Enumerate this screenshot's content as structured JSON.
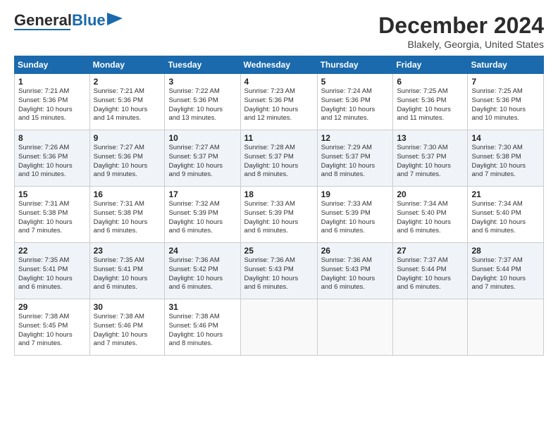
{
  "header": {
    "logo_general": "General",
    "logo_blue": "Blue",
    "month": "December 2024",
    "location": "Blakely, Georgia, United States"
  },
  "days_of_week": [
    "Sunday",
    "Monday",
    "Tuesday",
    "Wednesday",
    "Thursday",
    "Friday",
    "Saturday"
  ],
  "weeks": [
    [
      {
        "day": "1",
        "info": "Sunrise: 7:21 AM\nSunset: 5:36 PM\nDaylight: 10 hours\nand 15 minutes."
      },
      {
        "day": "2",
        "info": "Sunrise: 7:21 AM\nSunset: 5:36 PM\nDaylight: 10 hours\nand 14 minutes."
      },
      {
        "day": "3",
        "info": "Sunrise: 7:22 AM\nSunset: 5:36 PM\nDaylight: 10 hours\nand 13 minutes."
      },
      {
        "day": "4",
        "info": "Sunrise: 7:23 AM\nSunset: 5:36 PM\nDaylight: 10 hours\nand 12 minutes."
      },
      {
        "day": "5",
        "info": "Sunrise: 7:24 AM\nSunset: 5:36 PM\nDaylight: 10 hours\nand 12 minutes."
      },
      {
        "day": "6",
        "info": "Sunrise: 7:25 AM\nSunset: 5:36 PM\nDaylight: 10 hours\nand 11 minutes."
      },
      {
        "day": "7",
        "info": "Sunrise: 7:25 AM\nSunset: 5:36 PM\nDaylight: 10 hours\nand 10 minutes."
      }
    ],
    [
      {
        "day": "8",
        "info": "Sunrise: 7:26 AM\nSunset: 5:36 PM\nDaylight: 10 hours\nand 10 minutes."
      },
      {
        "day": "9",
        "info": "Sunrise: 7:27 AM\nSunset: 5:36 PM\nDaylight: 10 hours\nand 9 minutes."
      },
      {
        "day": "10",
        "info": "Sunrise: 7:27 AM\nSunset: 5:37 PM\nDaylight: 10 hours\nand 9 minutes."
      },
      {
        "day": "11",
        "info": "Sunrise: 7:28 AM\nSunset: 5:37 PM\nDaylight: 10 hours\nand 8 minutes."
      },
      {
        "day": "12",
        "info": "Sunrise: 7:29 AM\nSunset: 5:37 PM\nDaylight: 10 hours\nand 8 minutes."
      },
      {
        "day": "13",
        "info": "Sunrise: 7:30 AM\nSunset: 5:37 PM\nDaylight: 10 hours\nand 7 minutes."
      },
      {
        "day": "14",
        "info": "Sunrise: 7:30 AM\nSunset: 5:38 PM\nDaylight: 10 hours\nand 7 minutes."
      }
    ],
    [
      {
        "day": "15",
        "info": "Sunrise: 7:31 AM\nSunset: 5:38 PM\nDaylight: 10 hours\nand 7 minutes."
      },
      {
        "day": "16",
        "info": "Sunrise: 7:31 AM\nSunset: 5:38 PM\nDaylight: 10 hours\nand 6 minutes."
      },
      {
        "day": "17",
        "info": "Sunrise: 7:32 AM\nSunset: 5:39 PM\nDaylight: 10 hours\nand 6 minutes."
      },
      {
        "day": "18",
        "info": "Sunrise: 7:33 AM\nSunset: 5:39 PM\nDaylight: 10 hours\nand 6 minutes."
      },
      {
        "day": "19",
        "info": "Sunrise: 7:33 AM\nSunset: 5:39 PM\nDaylight: 10 hours\nand 6 minutes."
      },
      {
        "day": "20",
        "info": "Sunrise: 7:34 AM\nSunset: 5:40 PM\nDaylight: 10 hours\nand 6 minutes."
      },
      {
        "day": "21",
        "info": "Sunrise: 7:34 AM\nSunset: 5:40 PM\nDaylight: 10 hours\nand 6 minutes."
      }
    ],
    [
      {
        "day": "22",
        "info": "Sunrise: 7:35 AM\nSunset: 5:41 PM\nDaylight: 10 hours\nand 6 minutes."
      },
      {
        "day": "23",
        "info": "Sunrise: 7:35 AM\nSunset: 5:41 PM\nDaylight: 10 hours\nand 6 minutes."
      },
      {
        "day": "24",
        "info": "Sunrise: 7:36 AM\nSunset: 5:42 PM\nDaylight: 10 hours\nand 6 minutes."
      },
      {
        "day": "25",
        "info": "Sunrise: 7:36 AM\nSunset: 5:43 PM\nDaylight: 10 hours\nand 6 minutes."
      },
      {
        "day": "26",
        "info": "Sunrise: 7:36 AM\nSunset: 5:43 PM\nDaylight: 10 hours\nand 6 minutes."
      },
      {
        "day": "27",
        "info": "Sunrise: 7:37 AM\nSunset: 5:44 PM\nDaylight: 10 hours\nand 6 minutes."
      },
      {
        "day": "28",
        "info": "Sunrise: 7:37 AM\nSunset: 5:44 PM\nDaylight: 10 hours\nand 7 minutes."
      }
    ],
    [
      {
        "day": "29",
        "info": "Sunrise: 7:38 AM\nSunset: 5:45 PM\nDaylight: 10 hours\nand 7 minutes."
      },
      {
        "day": "30",
        "info": "Sunrise: 7:38 AM\nSunset: 5:46 PM\nDaylight: 10 hours\nand 7 minutes."
      },
      {
        "day": "31",
        "info": "Sunrise: 7:38 AM\nSunset: 5:46 PM\nDaylight: 10 hours\nand 8 minutes."
      },
      {
        "day": "",
        "info": ""
      },
      {
        "day": "",
        "info": ""
      },
      {
        "day": "",
        "info": ""
      },
      {
        "day": "",
        "info": ""
      }
    ]
  ]
}
